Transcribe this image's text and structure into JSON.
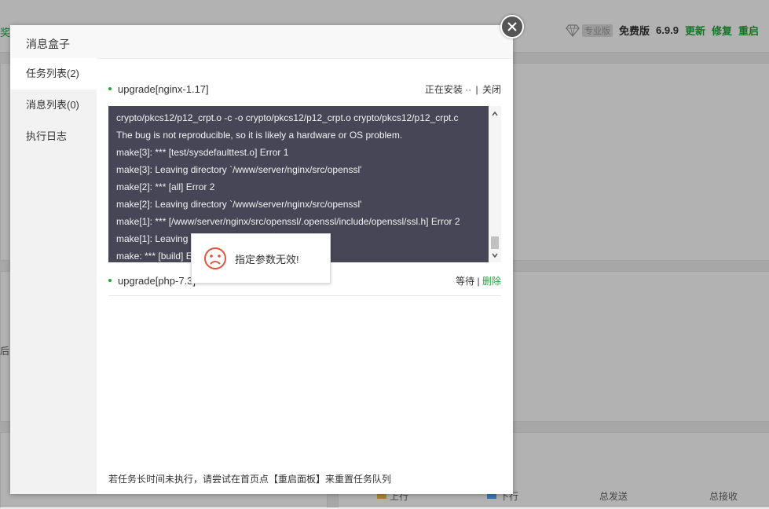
{
  "background": {
    "topbar_left_fragment": "奖",
    "pro_label": "专业版",
    "free_label": "免费版",
    "version": "6.9.9",
    "links": [
      "更新",
      "修复",
      "重启"
    ],
    "left_fragment_mid": "后",
    "footer": {
      "up_label": "上行",
      "down_label": "下行",
      "total_send": "总发送",
      "total_recv": "总接收",
      "up_color": "#f7b851",
      "down_color": "#52a9ff"
    }
  },
  "modal": {
    "title": "消息盒子",
    "close_icon": "close-icon",
    "sidebar": [
      {
        "label": "任务列表(2)",
        "active": true
      },
      {
        "label": "消息列表(0)",
        "active": false
      },
      {
        "label": "执行日志",
        "active": false
      }
    ],
    "tasks": [
      {
        "name": "upgrade[nginx-1.17]",
        "status": "正在安装 ··",
        "action": "关闭"
      },
      {
        "name": "upgrade[php-7.3]",
        "status": "等待",
        "action": "删除"
      }
    ],
    "console_lines": [
      "crypto/pkcs12/p12_crpt.o -c -o crypto/pkcs12/p12_crpt.o crypto/pkcs12/p12_crpt.c",
      "The bug is not reproducible, so it is likely a hardware or OS problem.",
      "make[3]: *** [test/sysdefaulttest.o] Error 1",
      "make[3]: Leaving directory `/www/server/nginx/src/openssl'",
      "make[2]: *** [all] Error 2",
      "make[2]: Leaving directory `/www/server/nginx/src/openssl'",
      "make[1]: *** [/www/server/nginx/src/openssl/.openssl/include/openssl/ssl.h] Error 2",
      "make[1]: Leaving",
      "make: *** [build] E"
    ],
    "footer_tip": "若任务长时间未执行，请尝试在首页点【重启面板】来重置任务队列"
  },
  "toast": {
    "icon": "sad-face-icon",
    "message": "指定参数无效!",
    "icon_color": "#e0543b"
  },
  "colors": {
    "accent": "#20a53a",
    "console_bg": "#464656"
  }
}
